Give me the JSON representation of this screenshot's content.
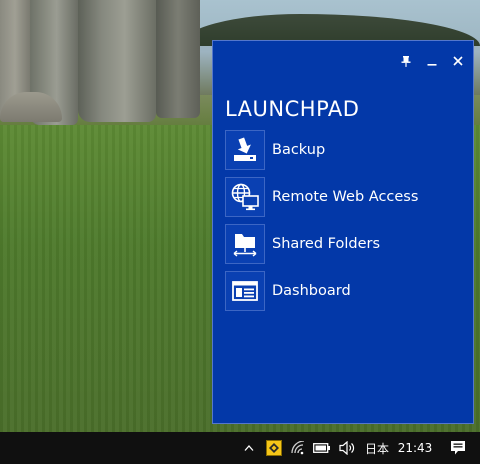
{
  "launchpad": {
    "title": "LAUNCHPAD",
    "controls": [
      {
        "name": "pin-icon"
      },
      {
        "name": "minimize-icon"
      },
      {
        "name": "close-icon"
      }
    ],
    "items": [
      {
        "label": "Backup",
        "icon": "backup-icon"
      },
      {
        "label": "Remote Web Access",
        "icon": "remote-web-access-icon"
      },
      {
        "label": "Shared Folders",
        "icon": "shared-folders-icon"
      },
      {
        "label": "Dashboard",
        "icon": "dashboard-icon"
      }
    ]
  },
  "taskbar": {
    "tray": {
      "language": "日本",
      "time": "21:43",
      "icons": [
        "show-hidden-icons-icon",
        "launchpad-tray-icon",
        "wifi-icon",
        "battery-icon",
        "volume-icon",
        "action-center-icon"
      ]
    }
  },
  "colors": {
    "launchpad_bg": "#0338a8",
    "taskbar_bg": "#101010",
    "tray_app_icon": "#f5c518"
  }
}
